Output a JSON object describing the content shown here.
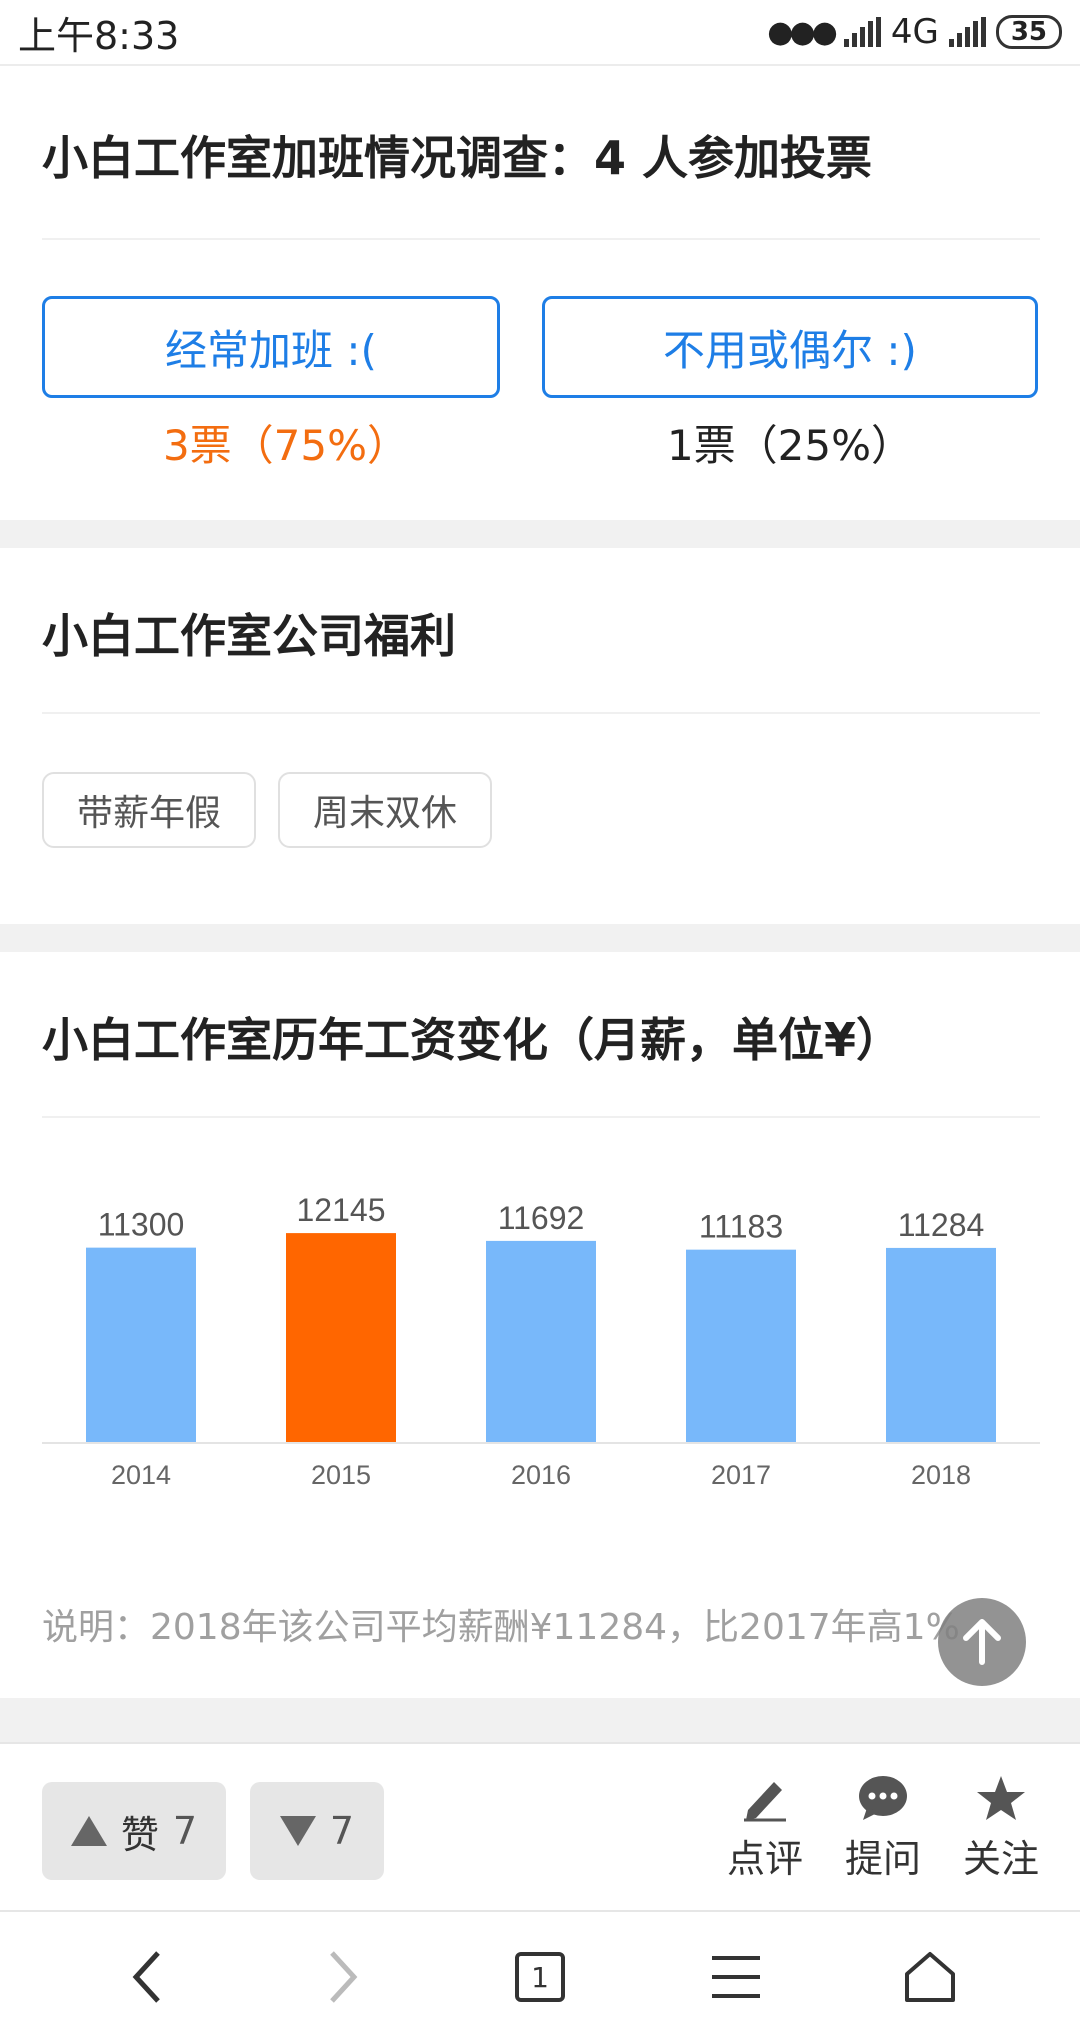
{
  "status_bar": {
    "time": "上午8:33",
    "network": "4G",
    "battery": "35"
  },
  "poll": {
    "title": "小白工作室加班情况调查：4 人参加投票",
    "options": [
      {
        "label": "经常加班 :(",
        "result": "3票（75%）",
        "color": "#f36d10"
      },
      {
        "label": "不用或偶尔 :)",
        "result": "1票（25%）",
        "color": "#222222"
      }
    ]
  },
  "benefits": {
    "title": "小白工作室公司福利",
    "tags": [
      "带薪年假",
      "周末双休"
    ]
  },
  "salary": {
    "title": "小白工作室历年工资变化（月薪，单位¥）",
    "note": "说明：2018年该公司平均薪酬¥11284，比2017年高1%"
  },
  "chart_data": {
    "type": "bar",
    "title": "小白工作室历年工资变化（月薪，单位¥）",
    "categories": [
      "2014",
      "2015",
      "2016",
      "2017",
      "2018"
    ],
    "values": [
      11300,
      12145,
      11692,
      11183,
      11284
    ],
    "highlight_index": 1,
    "colors": {
      "default": "#78b8fa",
      "highlight": "#ff6600"
    },
    "grid": false
  },
  "actions": {
    "like_label": "赞",
    "like_count": "7",
    "dislike_count": "7",
    "comment": "点评",
    "ask": "提问",
    "follow": "关注"
  },
  "nav": {
    "tab_count": "1"
  }
}
